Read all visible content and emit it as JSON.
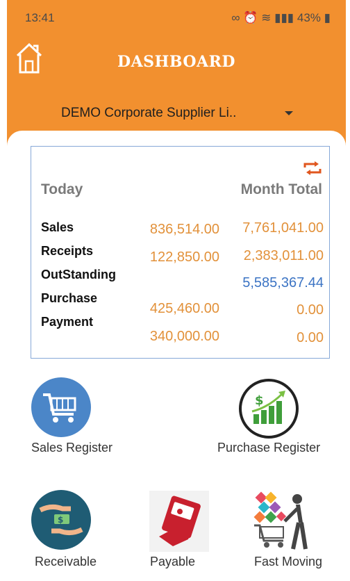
{
  "status_bar": {
    "time": "13:41",
    "battery": "43%"
  },
  "header": {
    "title": "DASHBOARD",
    "home_icon": "home-icon"
  },
  "company_select": {
    "value": "DEMO Corporate Supplier Li.."
  },
  "summary": {
    "today_label": "Today",
    "month_label": "Month Total",
    "rows": [
      {
        "label": "Sales",
        "today": "836,514.00",
        "month": "7,761,041.00"
      },
      {
        "label": "Receipts",
        "today": "122,850.00",
        "month": "2,383,011.00"
      },
      {
        "label": "OutStanding",
        "today": "",
        "month": "5,585,367.44"
      },
      {
        "label": "Purchase",
        "today": "425,460.00",
        "month": "0.00"
      },
      {
        "label": "Payment",
        "today": "340,000.00",
        "month": "0.00"
      }
    ]
  },
  "tiles": {
    "sales_register": "Sales Register",
    "purchase_register": "Purchase Register",
    "receivable": "Receivable",
    "payable": "Payable",
    "fast_moving": "Fast Moving"
  },
  "colors": {
    "header": "#f2902f",
    "value_orange": "#e2913a",
    "value_blue": "#3c74c4"
  }
}
